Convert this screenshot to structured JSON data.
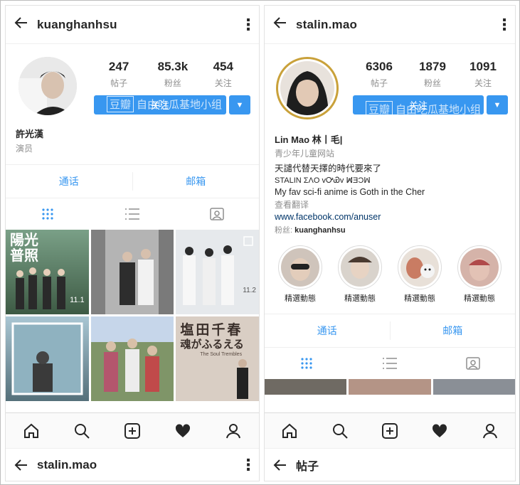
{
  "left": {
    "username": "kuanghanhsu",
    "stats": [
      {
        "num": "247",
        "label": "帖子"
      },
      {
        "num": "85.3k",
        "label": "粉丝"
      },
      {
        "num": "454",
        "label": "关注"
      }
    ],
    "follow_label": "关注",
    "watermark_box": "豆瓣",
    "watermark_text": "自由吃瓜基地小组",
    "display_name": "許光漢",
    "category": "演员",
    "call_label": "通话",
    "email_label": "邮箱",
    "next_username": "stalin.mao"
  },
  "right": {
    "username": "stalin.mao",
    "stats": [
      {
        "num": "6306",
        "label": "帖子"
      },
      {
        "num": "1879",
        "label": "粉丝"
      },
      {
        "num": "1091",
        "label": "关注"
      }
    ],
    "follow_label": "关注",
    "watermark_box": "豆瓣",
    "watermark_text": "自由吃瓜基地小组",
    "display_name": "Lin Mao 林丨毛|",
    "category": "青少年儿童网站",
    "bio_lines": [
      "天譴代替天擇的時代要來了",
      "STALIN ΣΛO vᎤᏯv ꟽ̸ƎƆꟽ",
      "My fav sci-fi anime is Goth in the Cher"
    ],
    "translate_label": "查看翻译",
    "link": "www.facebook.com/anuser",
    "fans_prefix": "粉丝:",
    "fans_user": "kuanghanhsu",
    "highlights": [
      "精選動態",
      "精選動態",
      "精選動態",
      "精選動態"
    ],
    "call_label": "通话",
    "email_label": "邮箱",
    "sub_title": "帖子"
  },
  "grid_text": {
    "poster1_title": "陽光普照",
    "poster1_date": "11.1",
    "poster3_date": "11.2",
    "poster6_title": "塩田千春",
    "poster6_sub": "魂がふるえる",
    "poster6_en": "The Soul Trembles"
  },
  "colors": {
    "accent": "#3897f0",
    "link": "#003569",
    "muted": "#8e8e8e"
  }
}
